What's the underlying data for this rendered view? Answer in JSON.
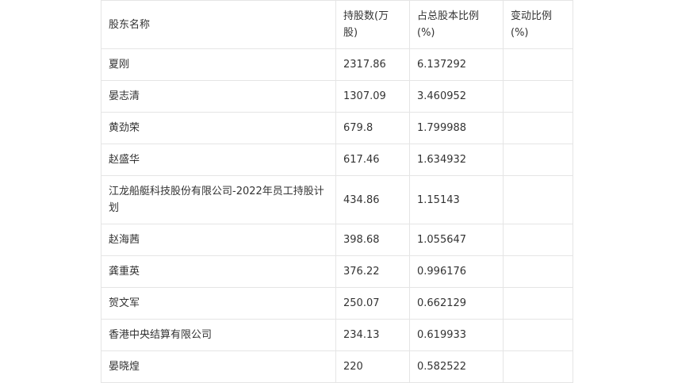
{
  "table": {
    "headers": [
      "股东名称",
      "持股数(万股)",
      "占总股本比例(%)",
      "变动比例(%)"
    ],
    "rows": [
      {
        "name": "夏刚",
        "shares": "2317.86",
        "ratio": "6.137292",
        "change": ""
      },
      {
        "name": "晏志清",
        "shares": "1307.09",
        "ratio": "3.460952",
        "change": ""
      },
      {
        "name": "黄劲荣",
        "shares": "679.8",
        "ratio": "1.799988",
        "change": ""
      },
      {
        "name": "赵盛华",
        "shares": "617.46",
        "ratio": "1.634932",
        "change": ""
      },
      {
        "name": "江龙船艇科技股份有限公司-2022年员工持股计划",
        "shares": "434.86",
        "ratio": "1.15143",
        "change": ""
      },
      {
        "name": "赵海茜",
        "shares": "398.68",
        "ratio": "1.055647",
        "change": ""
      },
      {
        "name": "龚重英",
        "shares": "376.22",
        "ratio": "0.996176",
        "change": ""
      },
      {
        "name": "贺文军",
        "shares": "250.07",
        "ratio": "0.662129",
        "change": ""
      },
      {
        "name": "香港中央结算有限公司",
        "shares": "234.13",
        "ratio": "0.619933",
        "change": ""
      },
      {
        "name": "晏晓煌",
        "shares": "220",
        "ratio": "0.582522",
        "change": ""
      }
    ]
  }
}
